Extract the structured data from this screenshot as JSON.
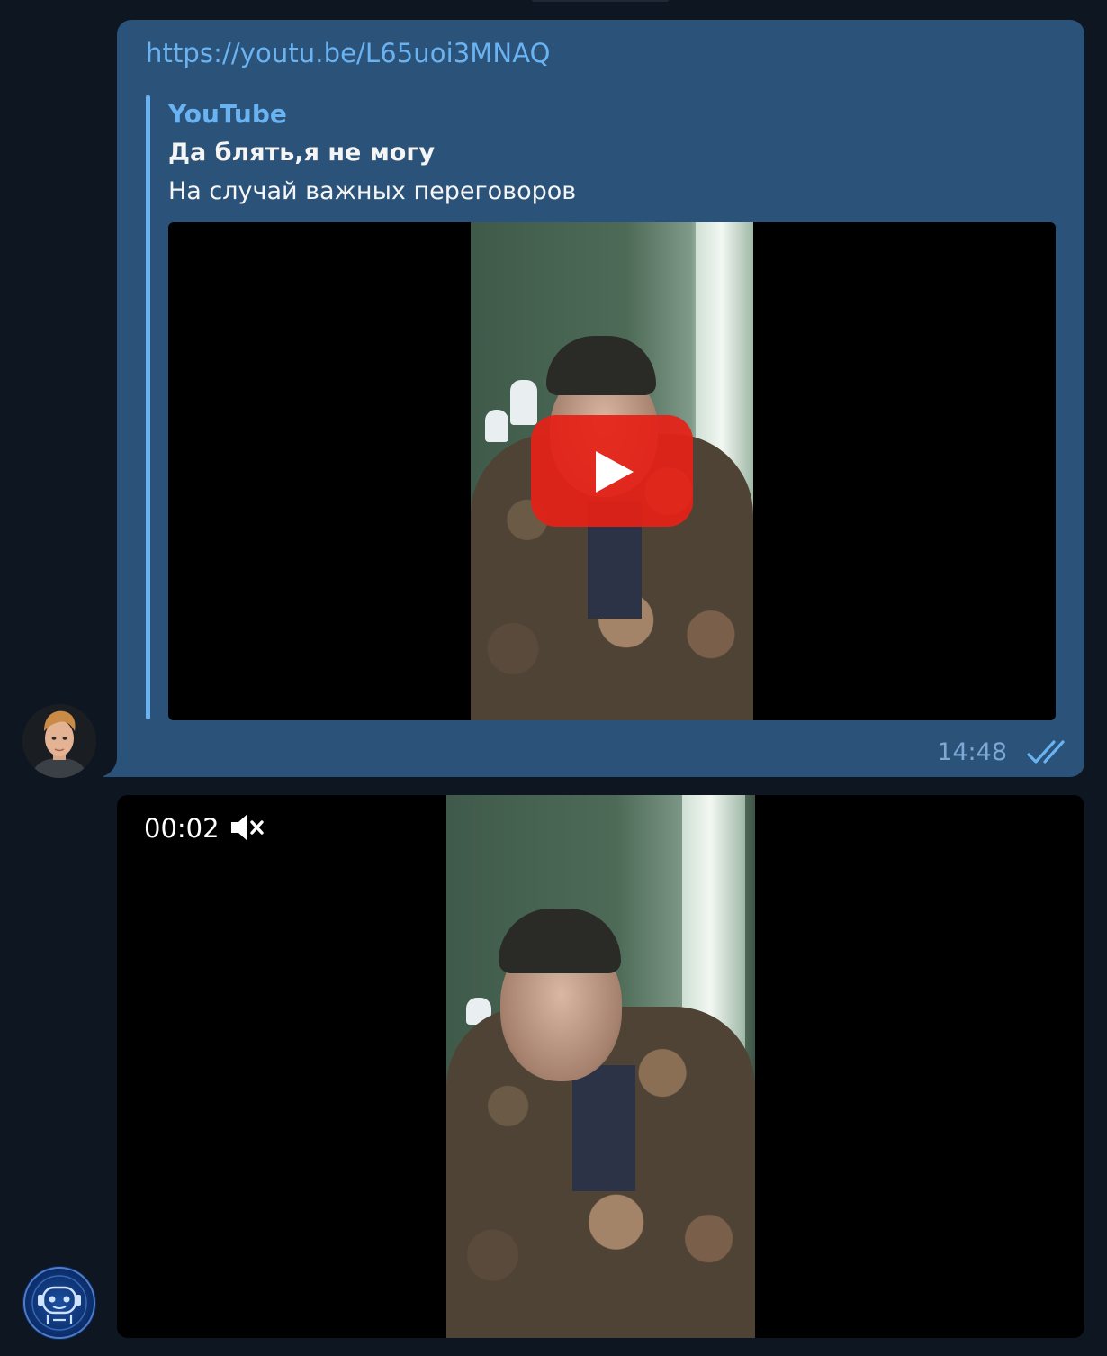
{
  "chat": {
    "message_1": {
      "link_url": "https://youtu.be/L65uoi3MNAQ",
      "preview": {
        "site_name": "YouTube",
        "title": "Да блять,я не могу",
        "description": "На случай важных переговоров"
      },
      "time": "14:48",
      "read_status": "double-check-icon"
    },
    "message_2": {
      "duration": "00:02",
      "muted": true,
      "mute_icon": "muted-speaker-icon"
    }
  },
  "colors": {
    "background": "#0e1621",
    "outgoing_bubble": "#2b5278",
    "link": "#6ab3f3",
    "time": "#7da8d3",
    "play_button": "#e62117"
  },
  "icons": {
    "play": "play-icon",
    "checks": "double-check-icon",
    "mute": "muted-speaker-icon"
  }
}
